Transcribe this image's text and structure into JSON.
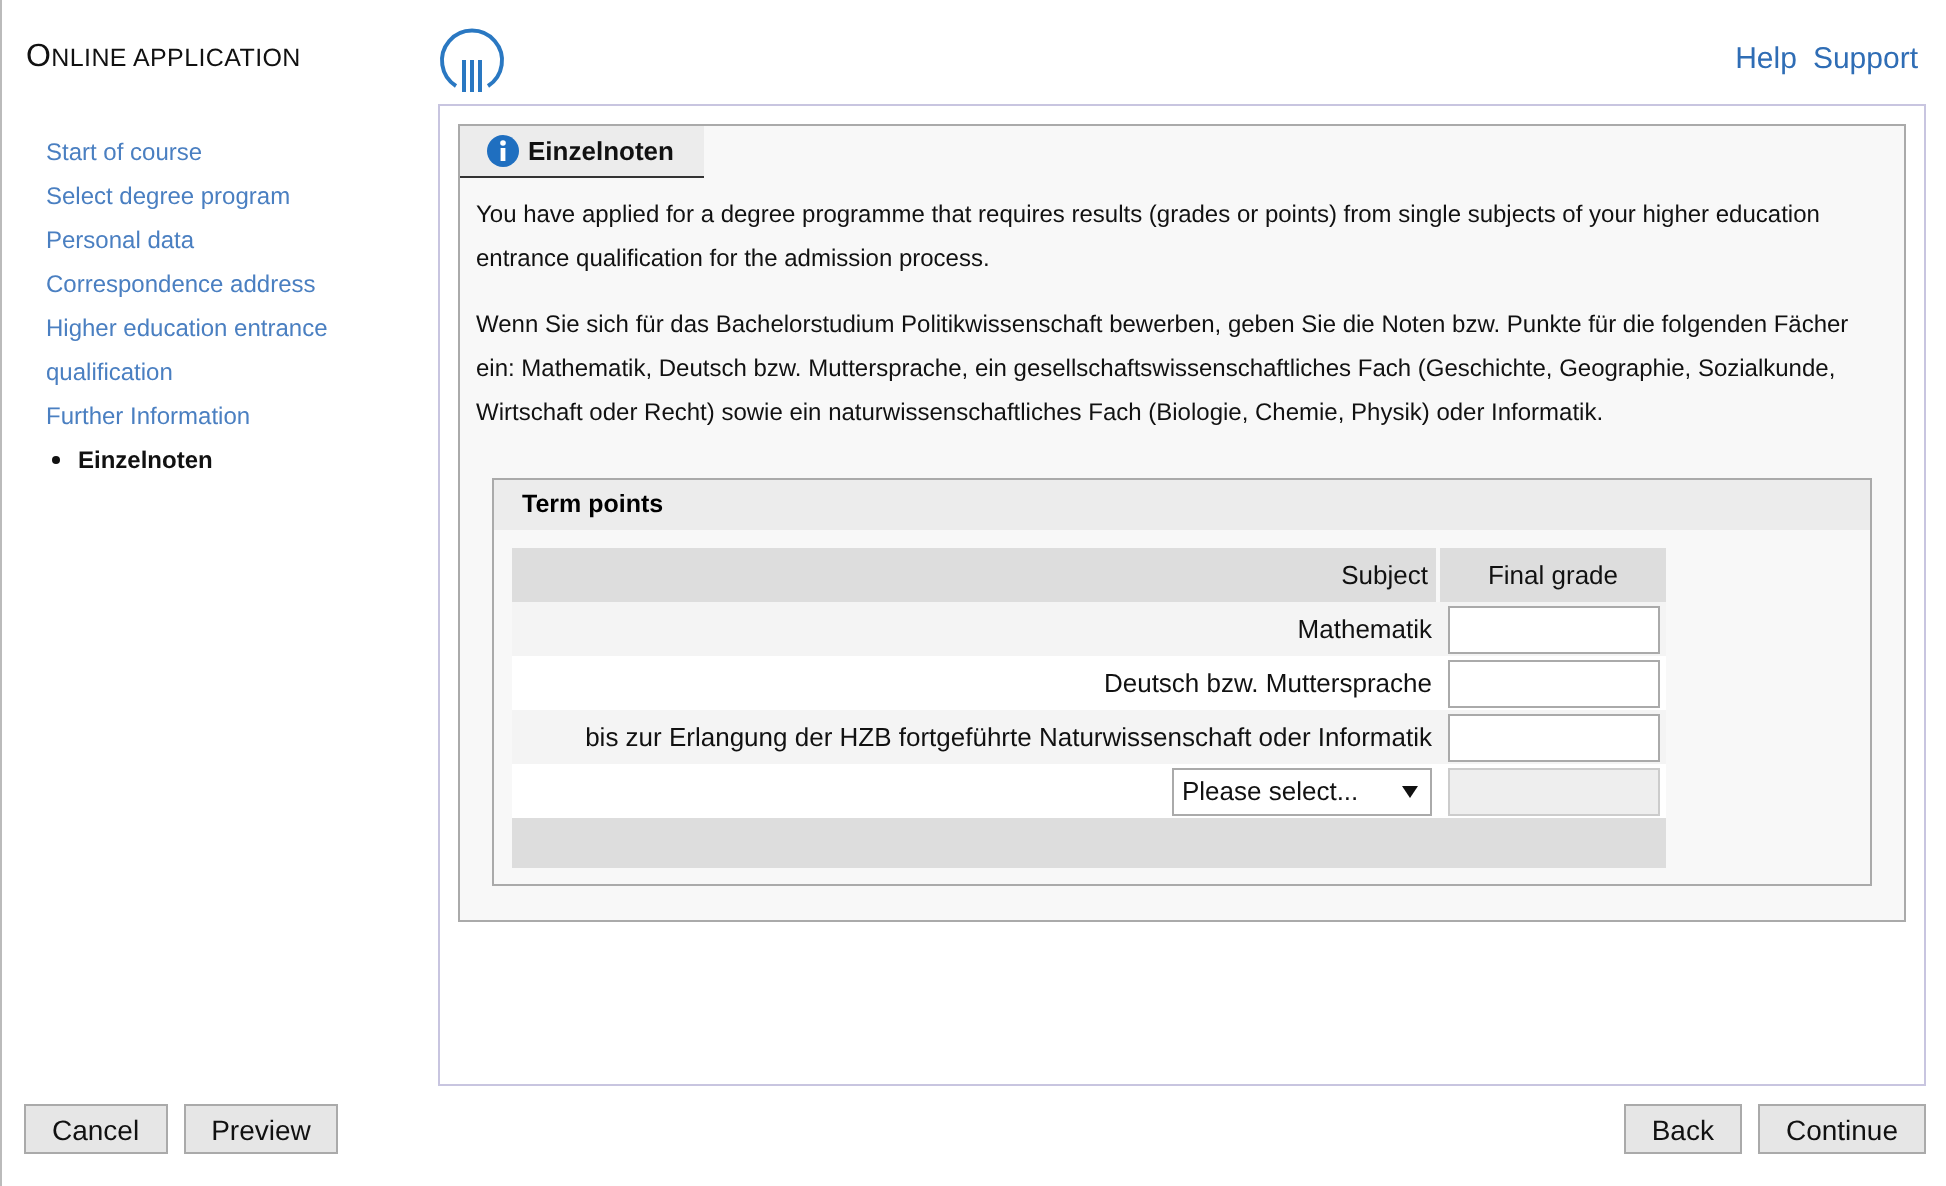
{
  "app_title": "ONLINE APPLICATION",
  "header_links": [
    "Help",
    "Support"
  ],
  "sidebar": {
    "items": [
      {
        "label": "Start of course",
        "selected": false
      },
      {
        "label": "Select degree program",
        "selected": false
      },
      {
        "label": "Personal data",
        "selected": false
      },
      {
        "label": "Correspondence address",
        "selected": false
      },
      {
        "label": "Higher education entrance qualification",
        "selected": false
      },
      {
        "label": "Further Information",
        "selected": false
      },
      {
        "label": "Einzelnoten",
        "selected": true
      }
    ]
  },
  "tab": {
    "label": "Einzelnoten"
  },
  "paragraphs": [
    "You have applied for a degree programme that requires results (grades or points) from single subjects of your higher education entrance qualification for the admission process.",
    "Wenn Sie sich für das Bachelorstudium Politikwissenschaft bewerben, geben Sie die Noten bzw. Punkte für die folgenden Fächer ein: Mathematik, Deutsch bzw. Muttersprache, ein gesellschaftswissenschaftliches Fach (Geschichte, Geographie, Sozialkunde, Wirtschaft oder Recht) sowie ein naturwissenschaftliches Fach (Biologie, Chemie, Physik) oder Informatik."
  ],
  "term_points": {
    "title": "Term points",
    "columns": [
      "Subject",
      "Final grade"
    ],
    "rows": [
      {
        "kind": "text",
        "subject": "Mathematik",
        "disabled": false
      },
      {
        "kind": "text",
        "subject": "Deutsch bzw. Muttersprache",
        "disabled": false
      },
      {
        "kind": "text",
        "subject": "bis zur Erlangung der HZB fortgeführte Naturwissenschaft oder Informatik",
        "disabled": false
      },
      {
        "kind": "select",
        "subject": "Please select...",
        "disabled": true
      }
    ]
  },
  "footer_left": [
    "Cancel",
    "Preview"
  ],
  "footer_right": [
    "Back",
    "Continue"
  ]
}
